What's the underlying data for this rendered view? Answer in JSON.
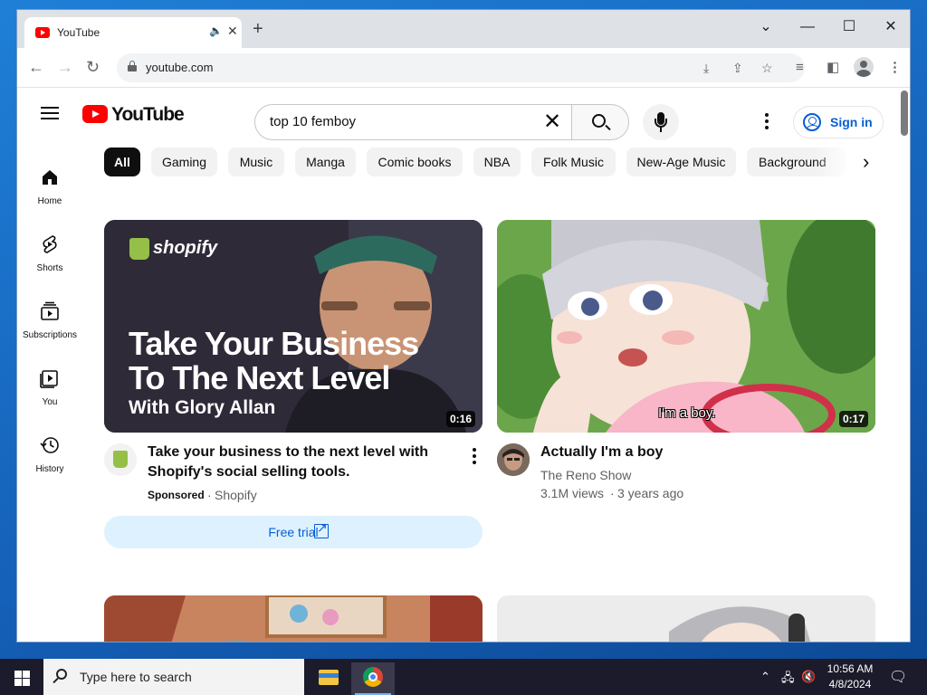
{
  "browser": {
    "tab_title": "YouTube",
    "url": "youtube.com",
    "new_tab_symbol": "+",
    "window_controls": [
      "chevron-down",
      "minimize",
      "maximize",
      "close"
    ]
  },
  "youtube": {
    "logo_text": "YouTube",
    "search_query": "top 10 femboy",
    "sign_in_label": "Sign in",
    "sidebar": [
      {
        "label": "Home",
        "icon": "home-icon"
      },
      {
        "label": "Shorts",
        "icon": "shorts-icon"
      },
      {
        "label": "Subscriptions",
        "icon": "subscriptions-icon"
      },
      {
        "label": "You",
        "icon": "you-icon"
      },
      {
        "label": "History",
        "icon": "history-icon"
      }
    ],
    "chips": [
      "All",
      "Gaming",
      "Music",
      "Manga",
      "Comic books",
      "NBA",
      "Folk Music",
      "New-Age Music",
      "Background"
    ],
    "active_chip": "All",
    "videos": [
      {
        "thumb_brand": "shopify",
        "thumb_headline_1": "Take Your Business",
        "thumb_headline_2": "To The Next Level",
        "thumb_subline": "With Glory Allan",
        "duration": "0:16",
        "title_line1": "Take your business to the next level with",
        "title_line2": "Shopify's social selling tools.",
        "sponsored": "Sponsored",
        "channel": "Shopify",
        "cta": "Free trial"
      },
      {
        "thumb_caption": "I'm a boy.",
        "duration": "0:17",
        "title": "Actually I'm a boy",
        "channel": "The Reno Show",
        "views": "3.1M views",
        "age": "3 years ago"
      }
    ]
  },
  "taskbar": {
    "search_placeholder": "Type here to search",
    "time": "10:56 AM",
    "date": "4/8/2024"
  },
  "colors": {
    "yt_red": "#ff0000",
    "link_blue": "#065fd4",
    "chip_bg": "#f2f2f2",
    "cta_bg": "#def1ff"
  }
}
